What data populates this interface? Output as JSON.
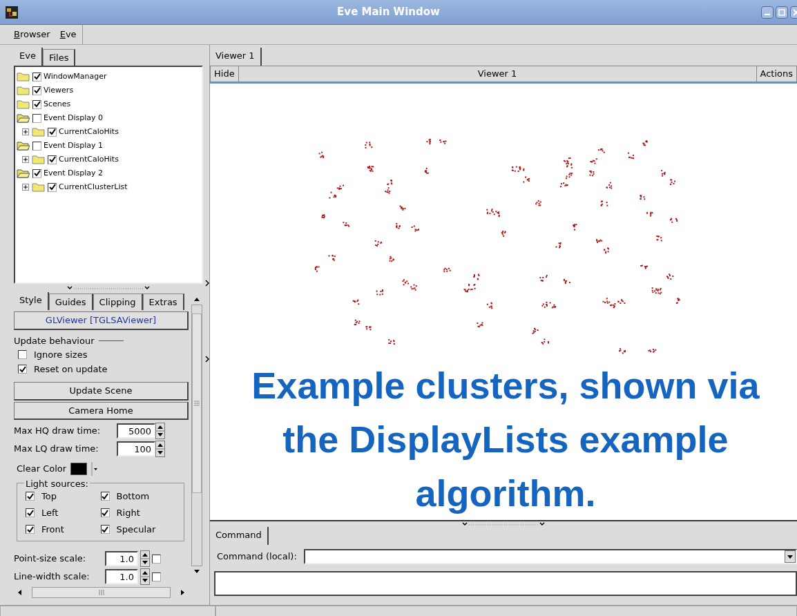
{
  "window": {
    "title": "Eve Main Window"
  },
  "menu": [
    {
      "label": "Browser"
    },
    {
      "label": "Eve"
    }
  ],
  "browser_tabs": [
    {
      "label": "Eve",
      "selected": true
    },
    {
      "label": "Files",
      "selected": false
    }
  ],
  "tree": [
    {
      "label": "WindowManager",
      "checked": true,
      "expanded": false
    },
    {
      "label": "Viewers",
      "checked": true,
      "expanded": false
    },
    {
      "label": "Scenes",
      "checked": true,
      "expanded": false
    },
    {
      "label": "Event Display 0",
      "checked": false,
      "expanded": true,
      "children": [
        {
          "label": "CurrentCaloHits",
          "checked": true,
          "expanded": false,
          "expander": true
        }
      ]
    },
    {
      "label": "Event Display 1",
      "checked": false,
      "expanded": true,
      "children": [
        {
          "label": "CurrentCaloHits",
          "checked": true,
          "expanded": false,
          "expander": true
        }
      ]
    },
    {
      "label": "Event Display 2",
      "checked": true,
      "expanded": true,
      "children": [
        {
          "label": "CurrentClusterList",
          "checked": true,
          "expanded": false,
          "expander": true
        }
      ]
    }
  ],
  "editor": {
    "tabs": [
      {
        "label": "Style",
        "selected": true
      },
      {
        "label": "Guides",
        "selected": false
      },
      {
        "label": "Clipping",
        "selected": false
      },
      {
        "label": "Extras",
        "selected": false
      }
    ],
    "title_button": "GLViewer [TGLSAViewer]",
    "update_behaviour": {
      "label": "Update behaviour",
      "options": [
        {
          "label": "Ignore sizes",
          "checked": false
        },
        {
          "label": "Reset on update",
          "checked": true
        }
      ]
    },
    "buttons": [
      "Update Scene",
      "Camera Home"
    ],
    "number_fields": [
      {
        "label": "Max HQ draw time:",
        "value": "5000"
      },
      {
        "label": "Max LQ draw time:",
        "value": "100"
      }
    ],
    "clear_color": {
      "label": "Clear Color",
      "color": "#000000"
    },
    "light_sources": {
      "label": "Light sources:",
      "options": [
        {
          "label": "Top",
          "checked": true
        },
        {
          "label": "Bottom",
          "checked": true
        },
        {
          "label": "Left",
          "checked": true
        },
        {
          "label": "Right",
          "checked": true
        },
        {
          "label": "Front",
          "checked": true
        },
        {
          "label": "Specular",
          "checked": true
        }
      ]
    },
    "scales": [
      {
        "label": "Point-size scale:",
        "value": "1.0",
        "checked": false
      },
      {
        "label": "Line-width scale:",
        "value": "1.0",
        "checked": false
      }
    ]
  },
  "viewer_tabs": [
    {
      "label": "Viewer 1",
      "selected": true
    }
  ],
  "viewer_header": {
    "hide": "Hide",
    "title": "Viewer 1",
    "actions": "Actions"
  },
  "caption": "Example clusters, shown via the DisplayLists example algorithm.",
  "command_tabs": [
    {
      "label": "Command",
      "selected": true
    }
  ],
  "command": {
    "label": "Command (local):"
  }
}
